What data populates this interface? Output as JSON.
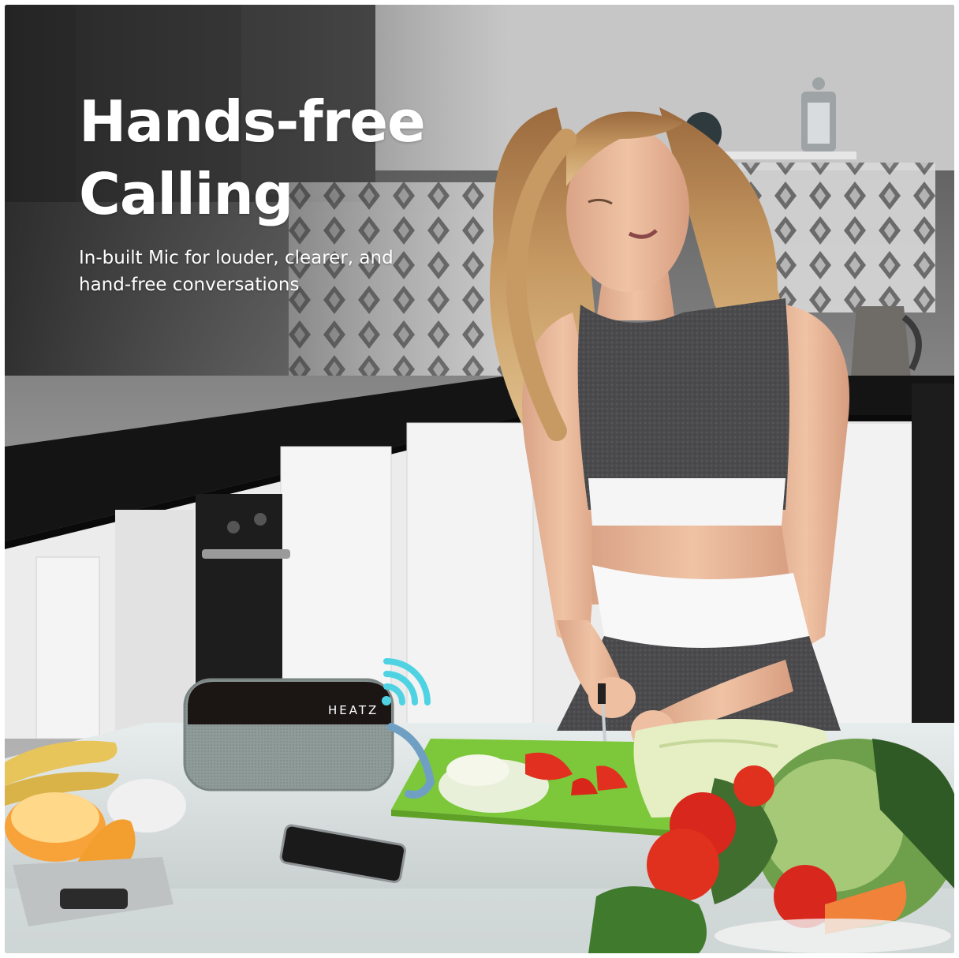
{
  "headline": {
    "line1": "Hands-free",
    "line2": "Calling"
  },
  "subtitle": {
    "line1": "In-built Mic for louder, clearer, and",
    "line2": "hand-free conversations"
  },
  "speaker": {
    "brand": "HEATZ"
  },
  "colors": {
    "wave_accent": "#4fd3e3",
    "headline_text": "#ffffff",
    "cabinet_white": "#f2f2f2",
    "countertop_black": "#141414",
    "speaker_grille": "#8e9a98",
    "cutting_board": "#7dc73a"
  },
  "icons": {
    "wireless_signal": "wifi-waves-icon"
  }
}
